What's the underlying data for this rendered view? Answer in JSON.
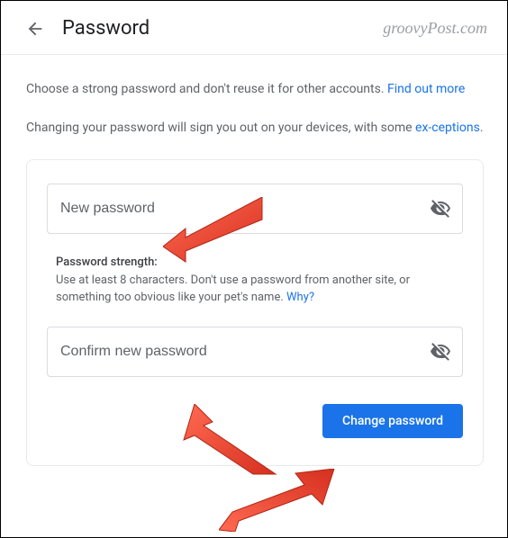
{
  "header": {
    "title": "Password",
    "watermark": "groovyPost.com"
  },
  "desc": {
    "text1": "Choose a strong password and don't reuse it for other accounts. ",
    "link1": "Find out more"
  },
  "desc2": {
    "text1": "Changing your password will sign you out on your devices, with some ",
    "link1": "ex-ceptions",
    "after": "."
  },
  "form": {
    "new_password_placeholder": "New password",
    "confirm_password_placeholder": "Confirm new password",
    "strength_label": "Password strength:",
    "strength_text": "Use at least 8 characters. Don't use a password from another site, or something too obvious like your pet's name. ",
    "strength_link": "Why?",
    "submit_label": "Change password"
  }
}
